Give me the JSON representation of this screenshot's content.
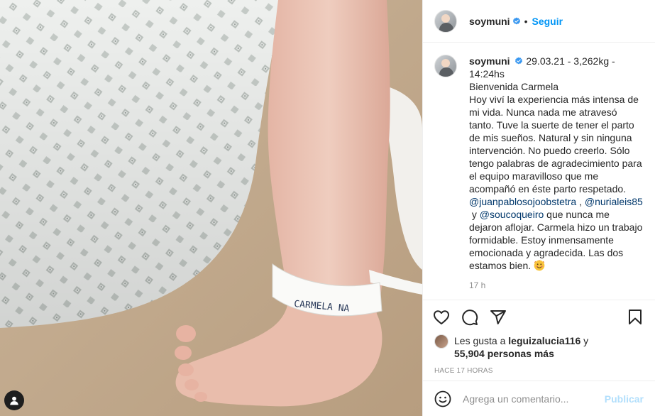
{
  "post": {
    "header": {
      "username": "soymuni",
      "separator": "•",
      "follow_label": "Seguir"
    },
    "caption": {
      "username": "soymuni",
      "lines": [
        "29.03.21 - 3,262kg -",
        "14:24hs",
        "Bienvenida Carmela",
        "Hoy viví la experiencia más intensa de mi vida. Nunca nada me atravesó tanto. Tuve la suerte de tener el parto de mis sueños. Natural y sin ninguna intervención. No puedo creerlo. Sólo tengo palabras de agradecimiento para el equipo maravilloso que me acompañó en éste parto respetado."
      ],
      "mention_1": "@juanpablosojoobstetra",
      "mention_sep": " ,",
      "mention_2": "@nurialeis85",
      "mention_join": " y ",
      "mention_3": "@soucoqueiro",
      "tail_text": " que nunca me dejaron aflojar. Carmela hizo un trabajo formidable. Estoy inmensamente emocionada y agradecida. Las dos estamos bien. ",
      "relative_time": "17 h"
    },
    "likes": {
      "prefix": "Les gusta a ",
      "user": "leguizalucia116",
      "connector": " y",
      "count": "55,904 personas más"
    },
    "timestamp": "HACE 17 HORAS",
    "comment_box": {
      "placeholder": "Agrega un comentario...",
      "publish_label": "Publicar"
    },
    "photo": {
      "wristband_text": "CARMELA  NA"
    }
  },
  "colors": {
    "accent": "#0095f6",
    "mention": "#00376b",
    "muted": "#8e8e8e",
    "publish_disabled": "#b2dffc",
    "verified": "#3897f0"
  },
  "icons": [
    "verified-badge-icon",
    "heart-icon",
    "comment-icon",
    "share-icon",
    "bookmark-icon",
    "emoji-icon",
    "user-tag-icon",
    "smiling-face-emoji-icon"
  ]
}
